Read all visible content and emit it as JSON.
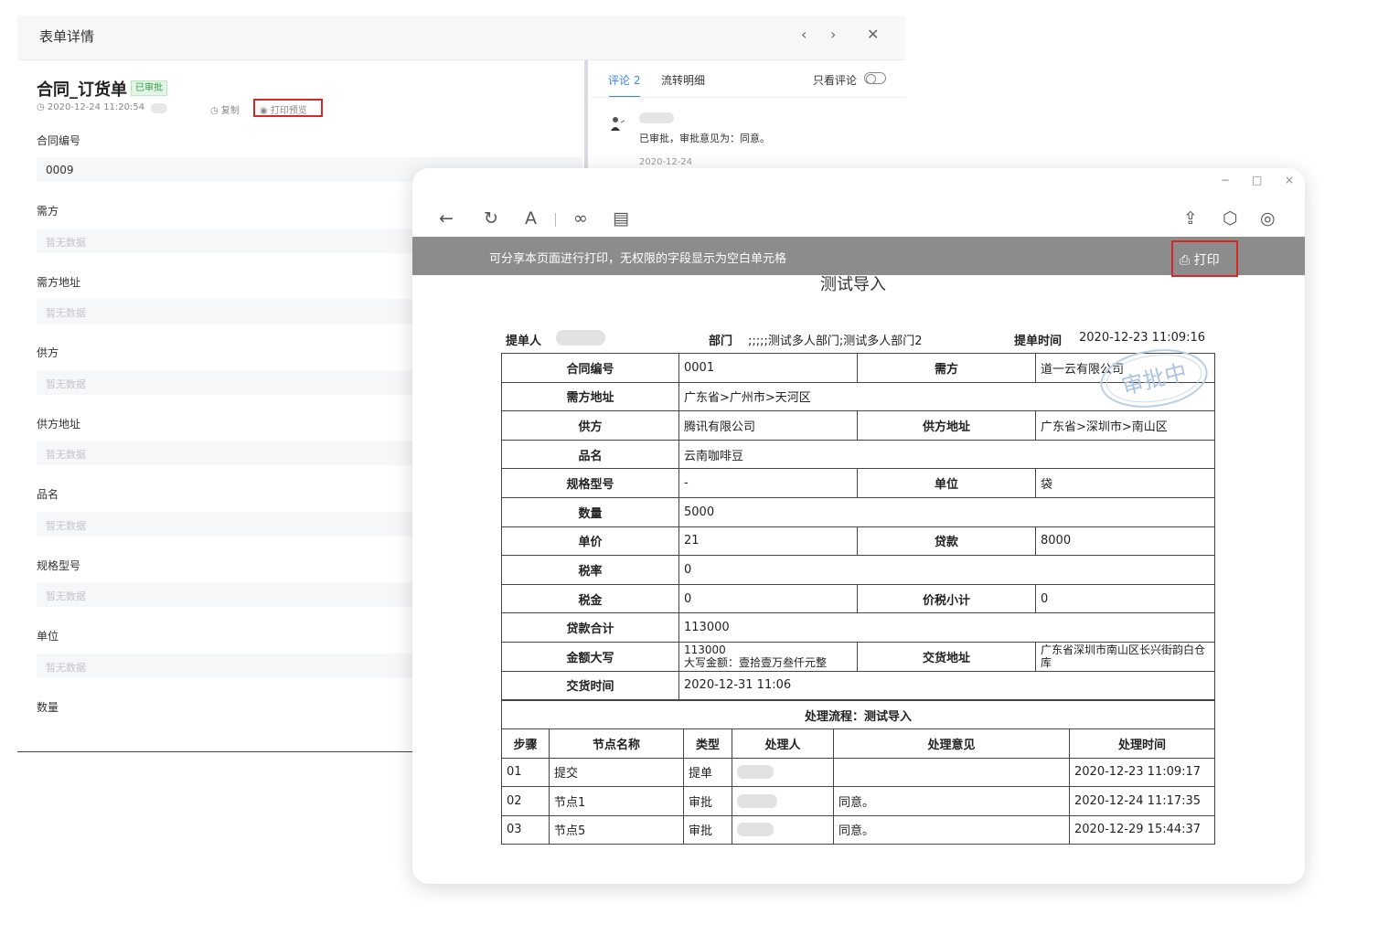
{
  "detail": {
    "header_title": "表单详情",
    "prev_icon": "‹",
    "next_icon": "›",
    "close_icon": "✕",
    "form_name": "合同_订货单",
    "status": "已审批",
    "time": "◷ 2020-12-24 11:20:54",
    "copy_label": "◷ 复制",
    "print_preview_label": "◉ 打印预览",
    "fields": [
      {
        "label": "合同编号",
        "value": "0009"
      },
      {
        "label": "需方",
        "value": "暂无数据"
      },
      {
        "label": "需方地址",
        "value": "暂无数据"
      },
      {
        "label": "供方",
        "value": "暂无数据"
      },
      {
        "label": "供方地址",
        "value": "暂无数据"
      },
      {
        "label": "品名",
        "value": "暂无数据"
      },
      {
        "label": "规格型号",
        "value": "暂无数据"
      },
      {
        "label": "单位",
        "value": "暂无数据"
      },
      {
        "label": "数量",
        "value": ""
      }
    ],
    "tabs": {
      "comments": "评论 2",
      "flow": "流转明细"
    },
    "only_comments": "只看评论",
    "comment": {
      "text": "已审批，审批意见为：同意。",
      "date": "2020-12-24"
    }
  },
  "preview": {
    "window_controls": {
      "minimize": "−",
      "maximize": "□",
      "close": "×"
    },
    "toolbar_icons": {
      "back": "←",
      "refresh": "↻",
      "font": "A",
      "link": "∞",
      "window": "▤",
      "share": "⇪",
      "box": "⬡",
      "target": "◎"
    },
    "banner_text": "可分享本页面进行打印，无权限的字段显示为空白单元格",
    "print_label": "打印",
    "print_icon": "⎙",
    "doc_title": "测试导入",
    "info": {
      "submitter_label": "提单人",
      "dept_label": "部门",
      "dept_value": ";;;;;测试多人部门;测试多人部门2",
      "submit_time_label": "提单时间",
      "submit_time_value": "2020-12-23 11:09:16"
    },
    "stamp_text": "审批中",
    "rows": {
      "r1": {
        "l1": "合同编号",
        "v1": "0001",
        "l2": "需方",
        "v2": "道一云有限公司"
      },
      "r2": {
        "l1": "需方地址",
        "v1": "广东省>广州市>天河区"
      },
      "r3": {
        "l1": "供方",
        "v1": "腾讯有限公司",
        "l2": "供方地址",
        "v2": "广东省>深圳市>南山区"
      },
      "r4": {
        "l1": "品名",
        "v1": "云南咖啡豆"
      },
      "r5": {
        "l1": "规格型号",
        "v1": "-",
        "l2": "单位",
        "v2": "袋"
      },
      "r6": {
        "l1": "数量",
        "v1": "5000"
      },
      "r7": {
        "l1": "单价",
        "v1": "21",
        "l2": "贷款",
        "v2": "8000"
      },
      "r8": {
        "l1": "税率",
        "v1": "0"
      },
      "r9": {
        "l1": "税金",
        "v1": "0",
        "l2": "价税小计",
        "v2": "0"
      },
      "r10": {
        "l1": "贷款合计",
        "v1": "113000"
      },
      "r11": {
        "l1": "金额大写",
        "v1a": "113000",
        "v1b": "大写金额：壹拾壹万叁仟元整",
        "l2": "交货地址",
        "v2": "广东省深圳市南山区长兴街韵白仓库"
      },
      "r12": {
        "l1": "交货时间",
        "v1": "2020-12-31 11:06"
      }
    },
    "process": {
      "title": "处理流程：测试导入",
      "headers": [
        "步骤",
        "节点名称",
        "类型",
        "处理人",
        "处理意见",
        "处理时间"
      ],
      "rows": [
        {
          "step": "01",
          "node": "提交",
          "type": "提单",
          "opinion": "",
          "time": "2020-12-23 11:09:17"
        },
        {
          "step": "02",
          "node": "节点1",
          "type": "审批",
          "opinion": "同意。",
          "time": "2020-12-24 11:17:35"
        },
        {
          "step": "03",
          "node": "节点5",
          "type": "审批",
          "opinion": "同意。",
          "time": "2020-12-29 15:44:37"
        }
      ]
    }
  }
}
